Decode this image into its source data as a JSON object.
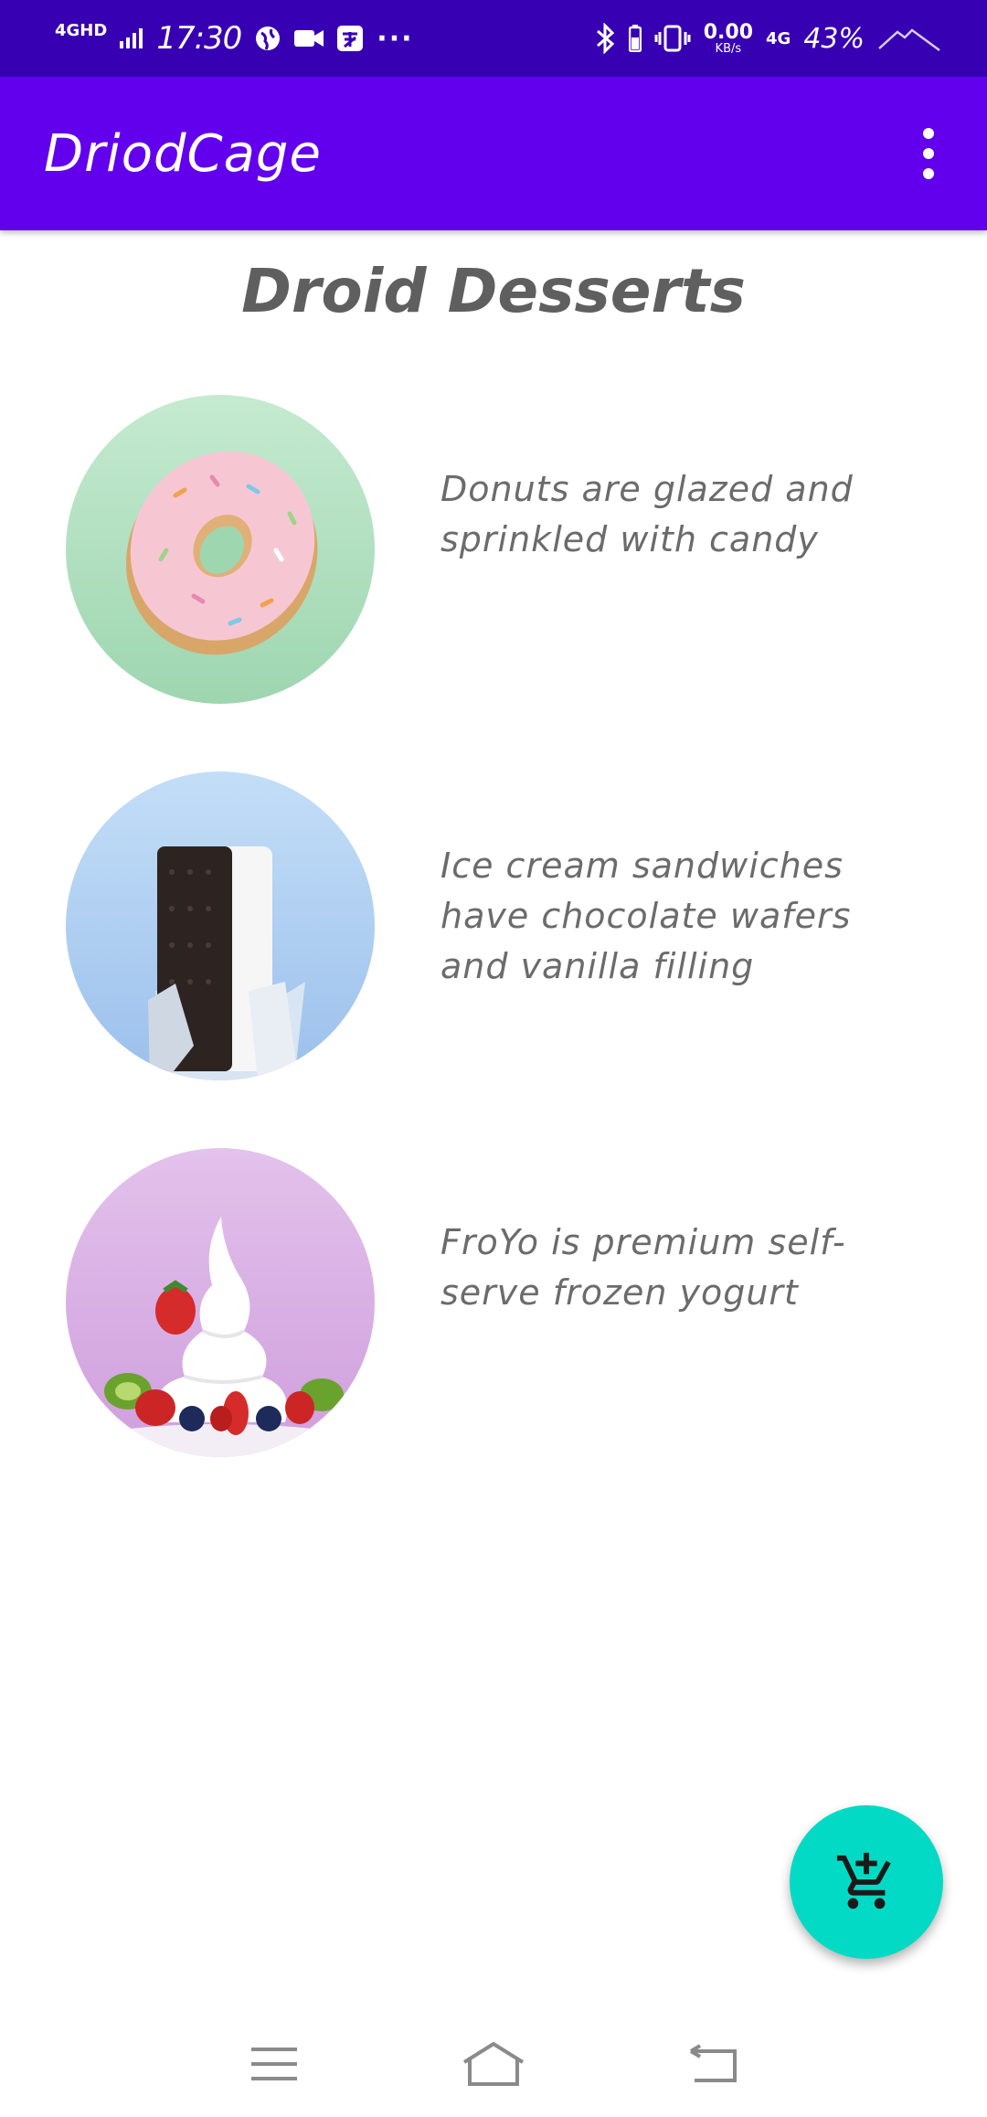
{
  "status_bar": {
    "network": "4GHD",
    "time": "17:30",
    "more": "···",
    "speed_value": "0.00",
    "speed_unit": "KB/s",
    "mobile": "4G",
    "battery": "43%"
  },
  "app_bar": {
    "title": "DriodCage",
    "overflow_icon": "more-vert-icon"
  },
  "page": {
    "heading": "Droid Desserts"
  },
  "desserts": [
    {
      "name": "donut",
      "description": "Donuts are glazed and sprinkled with candy",
      "bg": "#a8dcb8"
    },
    {
      "name": "ice-cream-sandwich",
      "description": "Ice cream sandwiches have chocolate wafers and vanilla filling",
      "bg": "#aac8f0"
    },
    {
      "name": "froyo",
      "description": "FroYo is premium self-serve frozen yogurt",
      "bg": "#d8b0e4"
    }
  ],
  "fab": {
    "icon": "add-shopping-cart-icon",
    "color": "#03DAC5"
  },
  "nav_bar": {
    "menu_icon": "menu-icon",
    "home_icon": "home-icon",
    "back_icon": "back-icon"
  },
  "colors": {
    "status_bar": "#3700B3",
    "app_bar": "#6200EE",
    "text": "#6b6b6b"
  }
}
